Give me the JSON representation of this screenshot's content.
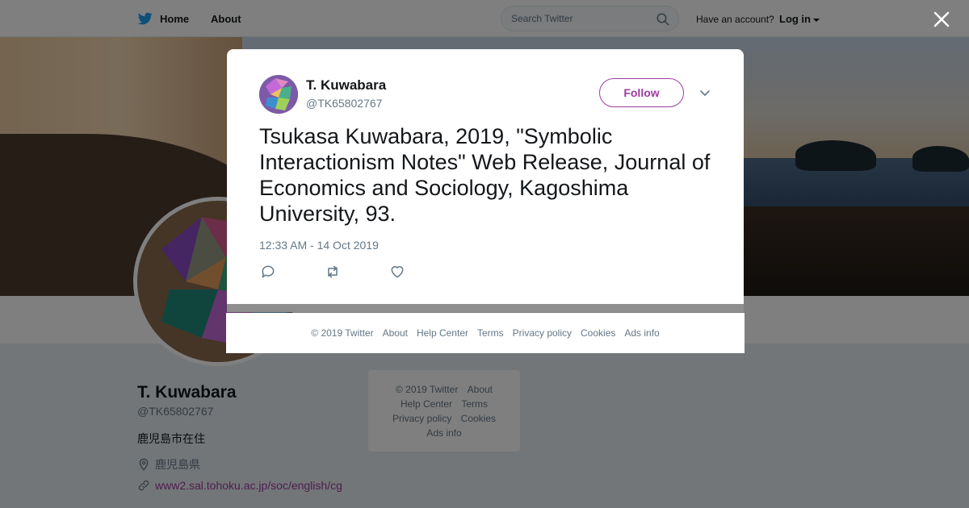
{
  "header": {
    "home_label": "Home",
    "about_label": "About",
    "search_placeholder": "Search Twitter",
    "have_account_label": "Have an account?",
    "login_label": "Log in"
  },
  "profile": {
    "name": "T. Kuwabara",
    "handle": "@TK65802767",
    "bio": "鹿児島市在住",
    "location": "鹿児島県",
    "url": "www2.sal.tohoku.ac.jp/soc/english/cg",
    "more": "..."
  },
  "side_footer": {
    "items": [
      "© 2019 Twitter",
      "About",
      "Help Center",
      "Terms",
      "Privacy policy",
      "Cookies",
      "Ads info"
    ]
  },
  "tweet": {
    "author_name": "T. Kuwabara",
    "author_handle": "@TK65802767",
    "follow_label": "Follow",
    "text": "Tsukasa Kuwabara, 2019, \"Symbolic Interactionism Notes\" Web Release, Journal of Economics and Sociology, Kagoshima University, 93.",
    "timestamp": "12:33 AM - 14 Oct 2019"
  },
  "modal_footer": {
    "items": [
      "© 2019 Twitter",
      "About",
      "Help Center",
      "Terms",
      "Privacy policy",
      "Cookies",
      "Ads info"
    ]
  },
  "icons": {
    "brand": "twitter-bird-icon",
    "search": "search-icon",
    "close": "close-icon",
    "chevron": "chevron-down-icon",
    "reply": "reply-icon",
    "retweet": "retweet-icon",
    "like": "heart-icon",
    "location": "location-pin-icon",
    "link": "link-icon"
  },
  "colors": {
    "twitter_blue": "#1da1f2",
    "link_accent": "#9e3d9e",
    "secondary_text": "#657786",
    "primary_text": "#14171a"
  }
}
